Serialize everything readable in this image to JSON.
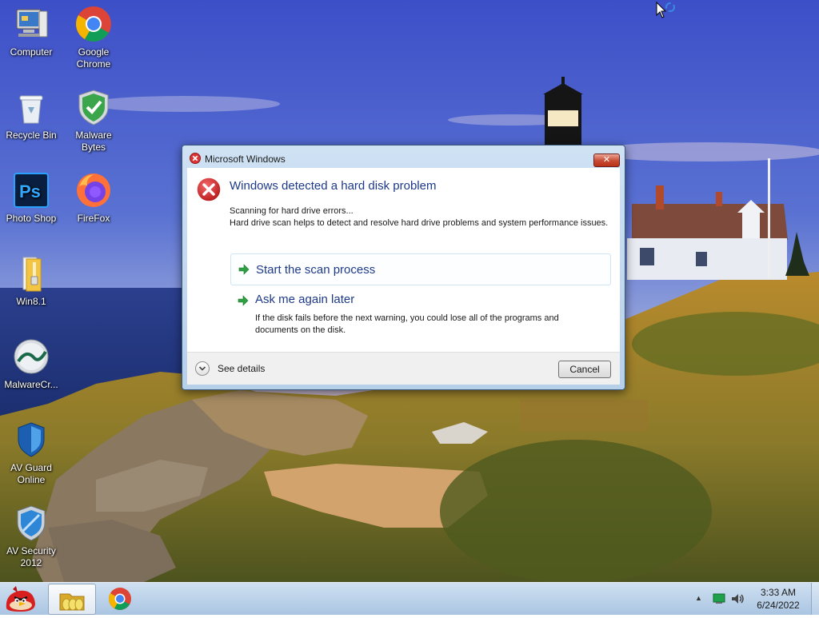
{
  "desktop": {
    "icons": [
      {
        "label": "Computer",
        "icon": "computer-icon"
      },
      {
        "label": "Google Chrome",
        "icon": "chrome-icon"
      },
      {
        "label": "Recycle Bin",
        "icon": "recycle-bin-icon"
      },
      {
        "label": "Malware Bytes",
        "icon": "malwarebytes-icon"
      },
      {
        "label": "Photo Shop",
        "icon": "photoshop-icon"
      },
      {
        "label": "FireFox",
        "icon": "firefox-icon"
      },
      {
        "label": "Win8.1",
        "icon": "folder-icon"
      },
      {
        "label": "MalwareCr...",
        "icon": "malware-crusher-icon"
      },
      {
        "label": "AV Guard Online",
        "icon": "shield-icon"
      },
      {
        "label": "AV Security 2012",
        "icon": "av-security-icon"
      }
    ],
    "wallpaper": "lighthouse-coast"
  },
  "dialog": {
    "title": "Microsoft Windows",
    "heading": "Windows detected a hard disk problem",
    "message_line1": "Scanning for hard drive errors...",
    "message_line2": "Hard drive scan helps to detect and resolve hard drive problems and system performance issues.",
    "option1_label": "Start the scan process",
    "option2_label": "Ask me again later",
    "option2_desc": "If the disk fails before the next warning, you could lose all of the programs and documents on the disk.",
    "details_label": "See details",
    "cancel_label": "Cancel",
    "close_glyph": "✕",
    "heading_color": "#1e3a8a"
  },
  "taskbar": {
    "clock_time": "3:33 AM",
    "clock_date": "6/24/2022",
    "tray_arrow": "▲",
    "pinned": [
      {
        "icon": "angry-birds-icon"
      },
      {
        "icon": "explorer-folder-icon",
        "active": true
      },
      {
        "icon": "chrome-icon"
      }
    ]
  }
}
